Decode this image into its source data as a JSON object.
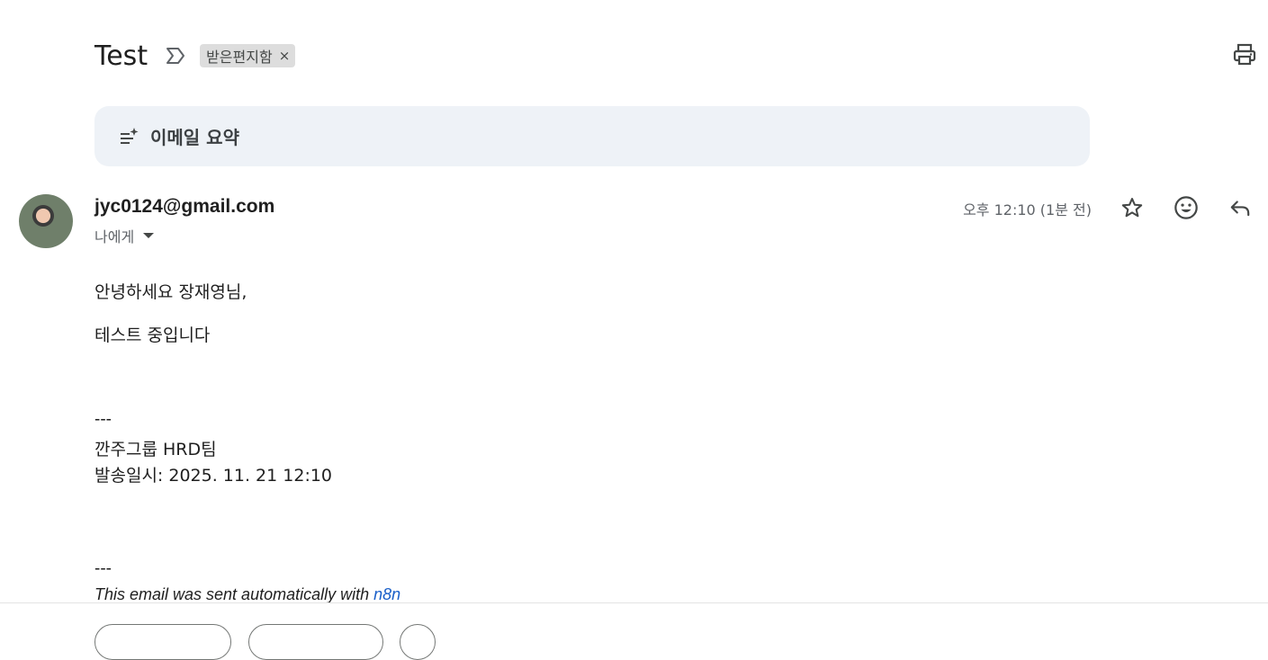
{
  "subject": {
    "title": "Test",
    "label": "받은편지함",
    "label_remove": "×"
  },
  "summary": {
    "label": "이메일 요약"
  },
  "sender": {
    "email": "jyc0124@gmail.com",
    "recipient": "나에게",
    "timestamp": "오후 12:10 (1분 전)"
  },
  "body": {
    "greeting": "안녕하세요 장재영님,",
    "message": "테스트 중입니다",
    "separator1": "---",
    "team": "깐주그룹 HRD팀",
    "sent_at": "발송일시: 2025. 11. 21 12:10",
    "separator2": "---",
    "footer_text": "This email was sent automatically with ",
    "footer_link": "n8n"
  },
  "icons": {
    "importance": "importance-marker-icon",
    "print": "print-icon",
    "summary": "sparkle-list-icon",
    "star": "star-icon",
    "emoji": "emoji-smile-icon",
    "reply": "reply-icon"
  },
  "colors": {
    "summary_bg": "#eef2f7",
    "label_chip_bg": "#dddddd",
    "link": "#1a5fc9"
  }
}
